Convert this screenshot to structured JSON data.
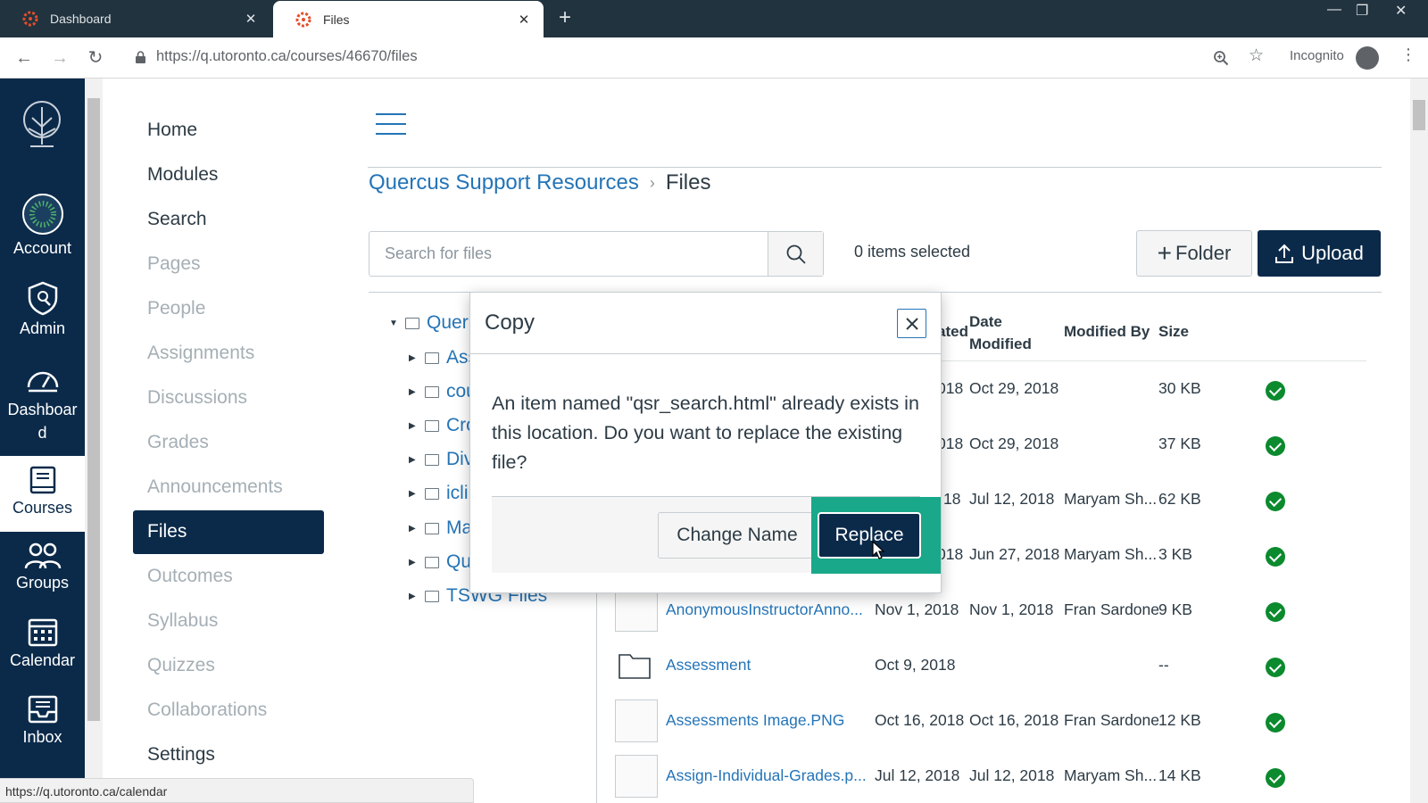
{
  "browser": {
    "tabs": [
      {
        "title": "Dashboard"
      },
      {
        "title": "Files"
      }
    ],
    "url": "https://q.utoronto.ca/courses/46670/files",
    "incognito_label": "Incognito",
    "status_url": "https://q.utoronto.ca/calendar"
  },
  "global_nav": {
    "items": [
      {
        "label": "Account",
        "icon": "account-icon"
      },
      {
        "label": "Admin",
        "icon": "admin-shield-icon"
      },
      {
        "label": "Dashboard",
        "icon": "dashboard-gauge-icon"
      },
      {
        "label": "Courses",
        "icon": "courses-book-icon"
      },
      {
        "label": "Groups",
        "icon": "groups-people-icon"
      },
      {
        "label": "Calendar",
        "icon": "calendar-icon"
      },
      {
        "label": "Inbox",
        "icon": "inbox-icon"
      }
    ]
  },
  "course_nav": {
    "items": [
      "Home",
      "Modules",
      "Search",
      "Pages",
      "People",
      "Assignments",
      "Discussions",
      "Grades",
      "Announcements",
      "Files",
      "Outcomes",
      "Syllabus",
      "Quizzes",
      "Collaborations",
      "Settings"
    ],
    "active": "Files"
  },
  "breadcrumb": {
    "course": "Quercus Support Resources",
    "current": "Files"
  },
  "toolbar": {
    "search_placeholder": "Search for files",
    "selected_count": "0 items selected",
    "folder_label": "Folder",
    "upload_label": "Upload"
  },
  "tree": [
    {
      "label": "Quer",
      "expanded": true
    },
    {
      "label": "Ass"
    },
    {
      "label": "cou"
    },
    {
      "label": "Cro"
    },
    {
      "label": "Div"
    },
    {
      "label": "icli"
    },
    {
      "label": "Ma"
    },
    {
      "label": "Qu"
    },
    {
      "label": "TSWG Files"
    }
  ],
  "table": {
    "headers": {
      "created": "ated",
      "modified": "Date Modified",
      "modified_by": "Modified By",
      "size": "Size"
    },
    "rows": [
      {
        "name": "",
        "created": "018",
        "modified": "Oct 29, 2018",
        "modified_by": "",
        "size": "30 KB"
      },
      {
        "name": "",
        "created": "018",
        "modified": "Oct 29, 2018",
        "modified_by": "",
        "size": "37 KB"
      },
      {
        "name": "",
        "created": "18",
        "modified": "Jul 12, 2018",
        "modified_by": "Maryam Sh...",
        "size": "62 KB"
      },
      {
        "name": "",
        "created": "018",
        "modified": "Jun 27, 2018",
        "modified_by": "Maryam Sh...",
        "size": "3 KB"
      },
      {
        "name": "AnonymousInstructorAnno...",
        "created": "Nov 1, 2018",
        "modified": "Nov 1, 2018",
        "modified_by": "Fran Sardone",
        "size": "9 KB"
      },
      {
        "name": "Assessment",
        "created": "Oct 9, 2018",
        "modified": "",
        "modified_by": "",
        "size": "--"
      },
      {
        "name": "Assessments Image.PNG",
        "created": "Oct 16, 2018",
        "modified": "Oct 16, 2018",
        "modified_by": "Fran Sardone",
        "size": "12 KB"
      },
      {
        "name": "Assign-Individual-Grades.p...",
        "created": "Jul 12, 2018",
        "modified": "Jul 12, 2018",
        "modified_by": "Maryam Sh...",
        "size": "14 KB"
      }
    ]
  },
  "modal": {
    "title": "Copy",
    "message": "An item named \"qsr_search.html\" already exists in this location. Do you want to replace the existing file?",
    "change_name_label": "Change Name",
    "replace_label": "Replace"
  },
  "colors": {
    "nav_bg": "#0b2a4a",
    "link": "#2474b7",
    "published": "#0b8a2e",
    "focus_ring": "#19a88a"
  }
}
